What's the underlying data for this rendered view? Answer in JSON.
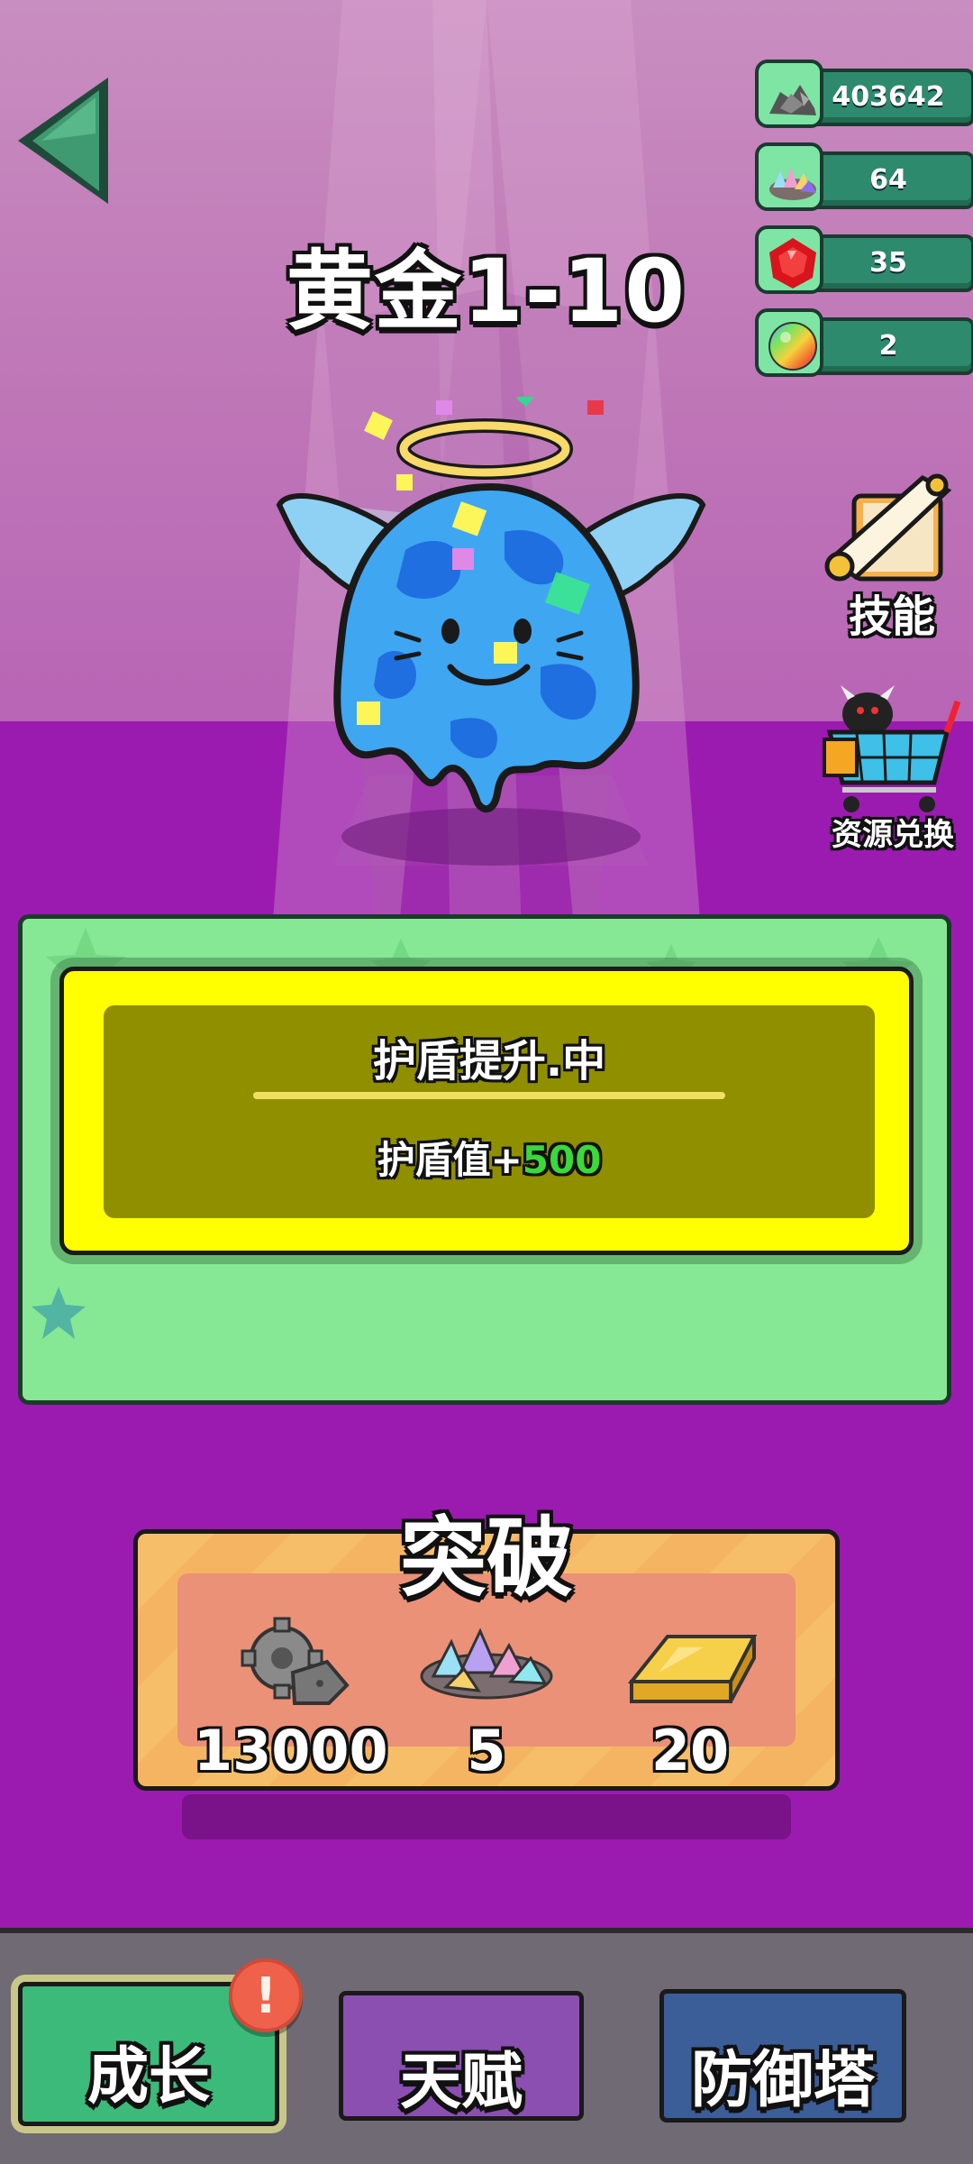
{
  "level": {
    "title": "黄金1-10"
  },
  "resources": [
    {
      "icon": "ore-pile-icon",
      "value": "403642"
    },
    {
      "icon": "crystal-pile-icon",
      "value": "64"
    },
    {
      "icon": "red-gem-icon",
      "value": "35"
    },
    {
      "icon": "rainbow-orb-icon",
      "value": "2"
    }
  ],
  "side": {
    "skill_label": "技能",
    "exchange_label": "资源兑换"
  },
  "reward_card": {
    "title": "护盾提升.中",
    "desc_prefix": "护盾值+",
    "desc_value": "500"
  },
  "breakthrough": {
    "title": "突破",
    "costs": [
      {
        "icon": "gear-ore-icon",
        "amount": "13000"
      },
      {
        "icon": "crystal-pile-icon",
        "amount": "5"
      },
      {
        "icon": "gold-bar-icon",
        "amount": "20"
      }
    ]
  },
  "nav": {
    "tabs": [
      {
        "label": "成长",
        "active": true
      },
      {
        "label": "天赋"
      },
      {
        "label": "防御塔"
      }
    ],
    "badge": "!"
  },
  "colors": {
    "accent_green": "#86e894",
    "card_yellow": "#ffff00",
    "bg_purple": "#9b1bb0",
    "value_green": "#3bd83b"
  }
}
